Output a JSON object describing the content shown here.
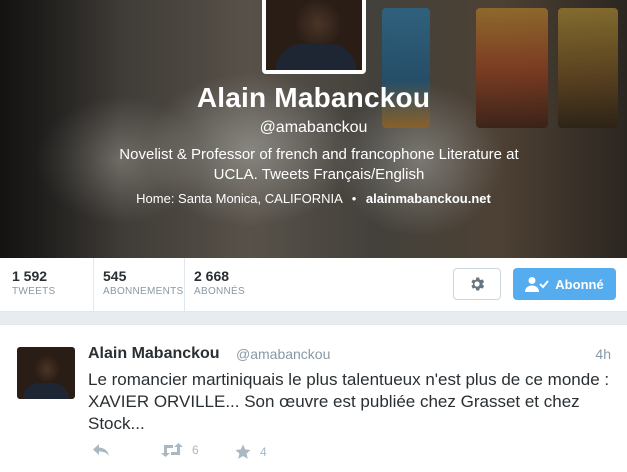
{
  "profile": {
    "name": "Alain Mabanckou",
    "handle": "@amabanckou",
    "bio": "Novelist & Professor of french and francophone Literature at UCLA. Tweets Français/English",
    "location_prefix": "Home: Santa Monica, CALIFORNIA",
    "separator": "•",
    "website": "alainmabanckou.net"
  },
  "stats": [
    {
      "value": "1 592",
      "label": "TWEETS"
    },
    {
      "value": "545",
      "label": "ABONNEMENTS"
    },
    {
      "value": "2 668",
      "label": "ABONNÉS"
    }
  ],
  "buttons": {
    "settings_icon": "gear-icon",
    "follow_label": "Abonné",
    "follow_icon": "user-check-icon"
  },
  "tweet": {
    "name": "Alain Mabanckou",
    "handle": "@amabanckou",
    "time": "4h",
    "text": "Le romancier martiniquais le plus talentueux n'est plus de ce monde : XAVIER ORVILLE... Son œuvre est publiée chez Grasset et chez Stock...",
    "retweets": "6",
    "favorites": "4"
  },
  "colors": {
    "accent": "#55acee",
    "muted": "#8899a6",
    "icon_gray": "#aab8c2"
  }
}
